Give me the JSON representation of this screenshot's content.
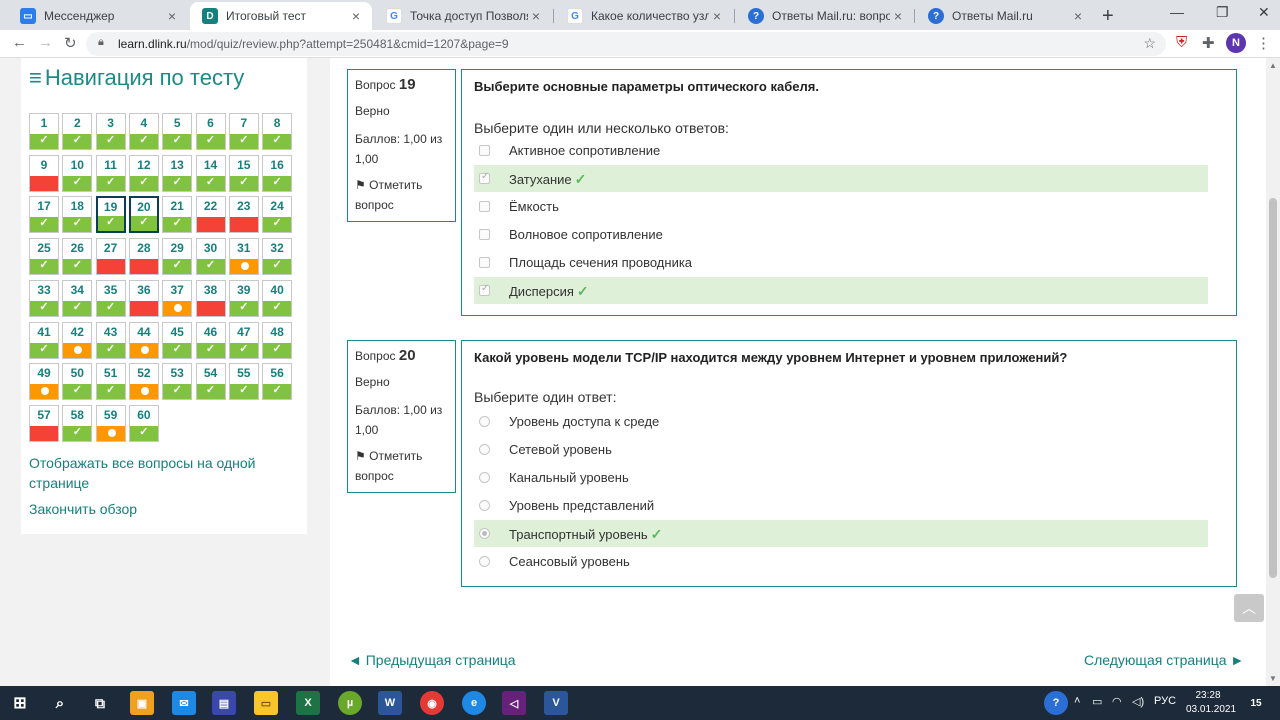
{
  "browser": {
    "tabs": [
      {
        "label": "Мессенджер",
        "icon": "messenger-icon",
        "color": "#2b7de9"
      },
      {
        "label": "Итоговый тест",
        "icon": "dlink-icon",
        "color": "#16807e"
      },
      {
        "label": "Точка доступ Позволяет об",
        "icon": "google-icon",
        "color": "#ffffff"
      },
      {
        "label": "Какое количество узлов до",
        "icon": "google-icon",
        "color": "#ffffff"
      },
      {
        "label": "Ответы Mail.ru: вопрос",
        "icon": "mailru-answers-icon",
        "color": "#2b6fd6"
      },
      {
        "label": "Ответы Mail.ru",
        "icon": "mailru-answers-icon",
        "color": "#2b6fd6"
      }
    ],
    "url_host": "learn.dlink.ru",
    "url_path": "/mod/quiz/review.php?attempt=250481&cmid=1207&page=9",
    "profile_initial": "N"
  },
  "nav": {
    "title": "Навигация по тесту",
    "link_show_all": "Отображать все вопросы на одной странице",
    "link_finish": "Закончить обзор",
    "questions": [
      {
        "n": "1",
        "s": "c"
      },
      {
        "n": "2",
        "s": "c"
      },
      {
        "n": "3",
        "s": "c"
      },
      {
        "n": "4",
        "s": "c"
      },
      {
        "n": "5",
        "s": "c"
      },
      {
        "n": "6",
        "s": "c"
      },
      {
        "n": "7",
        "s": "c"
      },
      {
        "n": "8",
        "s": "c"
      },
      {
        "n": "9",
        "s": "w"
      },
      {
        "n": "10",
        "s": "c"
      },
      {
        "n": "11",
        "s": "c"
      },
      {
        "n": "12",
        "s": "c"
      },
      {
        "n": "13",
        "s": "c"
      },
      {
        "n": "14",
        "s": "c"
      },
      {
        "n": "15",
        "s": "c"
      },
      {
        "n": "16",
        "s": "c"
      },
      {
        "n": "17",
        "s": "c"
      },
      {
        "n": "18",
        "s": "c"
      },
      {
        "n": "19",
        "s": "c",
        "cur": true
      },
      {
        "n": "20",
        "s": "c",
        "cur": true
      },
      {
        "n": "21",
        "s": "c"
      },
      {
        "n": "22",
        "s": "w"
      },
      {
        "n": "23",
        "s": "w"
      },
      {
        "n": "24",
        "s": "c"
      },
      {
        "n": "25",
        "s": "c"
      },
      {
        "n": "26",
        "s": "c"
      },
      {
        "n": "27",
        "s": "w"
      },
      {
        "n": "28",
        "s": "w"
      },
      {
        "n": "29",
        "s": "c"
      },
      {
        "n": "30",
        "s": "c"
      },
      {
        "n": "31",
        "s": "p"
      },
      {
        "n": "32",
        "s": "c"
      },
      {
        "n": "33",
        "s": "c"
      },
      {
        "n": "34",
        "s": "c"
      },
      {
        "n": "35",
        "s": "c"
      },
      {
        "n": "36",
        "s": "w"
      },
      {
        "n": "37",
        "s": "p"
      },
      {
        "n": "38",
        "s": "w"
      },
      {
        "n": "39",
        "s": "c"
      },
      {
        "n": "40",
        "s": "c"
      },
      {
        "n": "41",
        "s": "c"
      },
      {
        "n": "42",
        "s": "p"
      },
      {
        "n": "43",
        "s": "c"
      },
      {
        "n": "44",
        "s": "p"
      },
      {
        "n": "45",
        "s": "c"
      },
      {
        "n": "46",
        "s": "c"
      },
      {
        "n": "47",
        "s": "c"
      },
      {
        "n": "48",
        "s": "c"
      },
      {
        "n": "49",
        "s": "p"
      },
      {
        "n": "50",
        "s": "c"
      },
      {
        "n": "51",
        "s": "c"
      },
      {
        "n": "52",
        "s": "p"
      },
      {
        "n": "53",
        "s": "c"
      },
      {
        "n": "54",
        "s": "c"
      },
      {
        "n": "55",
        "s": "c"
      },
      {
        "n": "56",
        "s": "c"
      },
      {
        "n": "57",
        "s": "w"
      },
      {
        "n": "58",
        "s": "c"
      },
      {
        "n": "59",
        "s": "p"
      },
      {
        "n": "60",
        "s": "c"
      }
    ]
  },
  "q19": {
    "label": "Вопрос",
    "number": "19",
    "status": "Верно",
    "score": "Баллов: 1,00 из 1,00",
    "flag": "Отметить вопрос",
    "text": "Выберите основные параметры оптического кабеля.",
    "prompt": "Выберите один или несколько ответов:",
    "answers": [
      {
        "text": "Активное сопротивление",
        "checked": false,
        "correct": false
      },
      {
        "text": "Затухание",
        "checked": true,
        "correct": true
      },
      {
        "text": "Ёмкость",
        "checked": false,
        "correct": false
      },
      {
        "text": "Волновое сопротивление",
        "checked": false,
        "correct": false
      },
      {
        "text": "Площадь сечения проводника",
        "checked": false,
        "correct": false
      },
      {
        "text": "Дисперсия",
        "checked": true,
        "correct": true
      }
    ]
  },
  "q20": {
    "label": "Вопрос",
    "number": "20",
    "status": "Верно",
    "score": "Баллов: 1,00 из 1,00",
    "flag": "Отметить вопрос",
    "text": "Какой уровень модели TCP/IP находится между уровнем Интернет и уровнем приложений?",
    "prompt": "Выберите один ответ:",
    "answers": [
      {
        "text": "Уровень доступа к среде",
        "checked": false,
        "correct": false
      },
      {
        "text": "Сетевой уровень",
        "checked": false,
        "correct": false
      },
      {
        "text": "Канальный уровень",
        "checked": false,
        "correct": false
      },
      {
        "text": "Уровень представлений",
        "checked": false,
        "correct": false
      },
      {
        "text": "Транспортный уровень",
        "checked": true,
        "correct": true
      },
      {
        "text": "Сеансовый уровень",
        "checked": false,
        "correct": false
      }
    ]
  },
  "pager": {
    "prev": "◄ Предыдущая страница",
    "next": "Следующая страница ►"
  },
  "taskbar": {
    "lang": "РУС",
    "time": "23:28",
    "date": "03.01.2021",
    "notifications": "15"
  },
  "colors": {
    "accent": "#16807e",
    "correct": "#81c341",
    "wrong": "#f44336",
    "partial": "#ff9800"
  }
}
